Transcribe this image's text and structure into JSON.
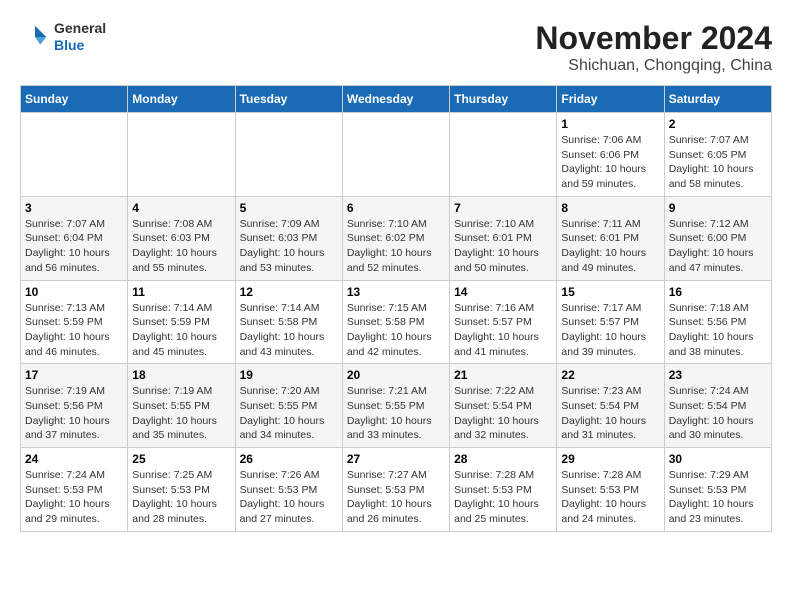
{
  "header": {
    "logo_general": "General",
    "logo_blue": "Blue",
    "title": "November 2024",
    "location": "Shichuan, Chongqing, China"
  },
  "days_of_week": [
    "Sunday",
    "Monday",
    "Tuesday",
    "Wednesday",
    "Thursday",
    "Friday",
    "Saturday"
  ],
  "weeks": [
    [
      {
        "day": "",
        "info": ""
      },
      {
        "day": "",
        "info": ""
      },
      {
        "day": "",
        "info": ""
      },
      {
        "day": "",
        "info": ""
      },
      {
        "day": "",
        "info": ""
      },
      {
        "day": "1",
        "info": "Sunrise: 7:06 AM\nSunset: 6:06 PM\nDaylight: 10 hours and 59 minutes."
      },
      {
        "day": "2",
        "info": "Sunrise: 7:07 AM\nSunset: 6:05 PM\nDaylight: 10 hours and 58 minutes."
      }
    ],
    [
      {
        "day": "3",
        "info": "Sunrise: 7:07 AM\nSunset: 6:04 PM\nDaylight: 10 hours and 56 minutes."
      },
      {
        "day": "4",
        "info": "Sunrise: 7:08 AM\nSunset: 6:03 PM\nDaylight: 10 hours and 55 minutes."
      },
      {
        "day": "5",
        "info": "Sunrise: 7:09 AM\nSunset: 6:03 PM\nDaylight: 10 hours and 53 minutes."
      },
      {
        "day": "6",
        "info": "Sunrise: 7:10 AM\nSunset: 6:02 PM\nDaylight: 10 hours and 52 minutes."
      },
      {
        "day": "7",
        "info": "Sunrise: 7:10 AM\nSunset: 6:01 PM\nDaylight: 10 hours and 50 minutes."
      },
      {
        "day": "8",
        "info": "Sunrise: 7:11 AM\nSunset: 6:01 PM\nDaylight: 10 hours and 49 minutes."
      },
      {
        "day": "9",
        "info": "Sunrise: 7:12 AM\nSunset: 6:00 PM\nDaylight: 10 hours and 47 minutes."
      }
    ],
    [
      {
        "day": "10",
        "info": "Sunrise: 7:13 AM\nSunset: 5:59 PM\nDaylight: 10 hours and 46 minutes."
      },
      {
        "day": "11",
        "info": "Sunrise: 7:14 AM\nSunset: 5:59 PM\nDaylight: 10 hours and 45 minutes."
      },
      {
        "day": "12",
        "info": "Sunrise: 7:14 AM\nSunset: 5:58 PM\nDaylight: 10 hours and 43 minutes."
      },
      {
        "day": "13",
        "info": "Sunrise: 7:15 AM\nSunset: 5:58 PM\nDaylight: 10 hours and 42 minutes."
      },
      {
        "day": "14",
        "info": "Sunrise: 7:16 AM\nSunset: 5:57 PM\nDaylight: 10 hours and 41 minutes."
      },
      {
        "day": "15",
        "info": "Sunrise: 7:17 AM\nSunset: 5:57 PM\nDaylight: 10 hours and 39 minutes."
      },
      {
        "day": "16",
        "info": "Sunrise: 7:18 AM\nSunset: 5:56 PM\nDaylight: 10 hours and 38 minutes."
      }
    ],
    [
      {
        "day": "17",
        "info": "Sunrise: 7:19 AM\nSunset: 5:56 PM\nDaylight: 10 hours and 37 minutes."
      },
      {
        "day": "18",
        "info": "Sunrise: 7:19 AM\nSunset: 5:55 PM\nDaylight: 10 hours and 35 minutes."
      },
      {
        "day": "19",
        "info": "Sunrise: 7:20 AM\nSunset: 5:55 PM\nDaylight: 10 hours and 34 minutes."
      },
      {
        "day": "20",
        "info": "Sunrise: 7:21 AM\nSunset: 5:55 PM\nDaylight: 10 hours and 33 minutes."
      },
      {
        "day": "21",
        "info": "Sunrise: 7:22 AM\nSunset: 5:54 PM\nDaylight: 10 hours and 32 minutes."
      },
      {
        "day": "22",
        "info": "Sunrise: 7:23 AM\nSunset: 5:54 PM\nDaylight: 10 hours and 31 minutes."
      },
      {
        "day": "23",
        "info": "Sunrise: 7:24 AM\nSunset: 5:54 PM\nDaylight: 10 hours and 30 minutes."
      }
    ],
    [
      {
        "day": "24",
        "info": "Sunrise: 7:24 AM\nSunset: 5:53 PM\nDaylight: 10 hours and 29 minutes."
      },
      {
        "day": "25",
        "info": "Sunrise: 7:25 AM\nSunset: 5:53 PM\nDaylight: 10 hours and 28 minutes."
      },
      {
        "day": "26",
        "info": "Sunrise: 7:26 AM\nSunset: 5:53 PM\nDaylight: 10 hours and 27 minutes."
      },
      {
        "day": "27",
        "info": "Sunrise: 7:27 AM\nSunset: 5:53 PM\nDaylight: 10 hours and 26 minutes."
      },
      {
        "day": "28",
        "info": "Sunrise: 7:28 AM\nSunset: 5:53 PM\nDaylight: 10 hours and 25 minutes."
      },
      {
        "day": "29",
        "info": "Sunrise: 7:28 AM\nSunset: 5:53 PM\nDaylight: 10 hours and 24 minutes."
      },
      {
        "day": "30",
        "info": "Sunrise: 7:29 AM\nSunset: 5:53 PM\nDaylight: 10 hours and 23 minutes."
      }
    ]
  ]
}
